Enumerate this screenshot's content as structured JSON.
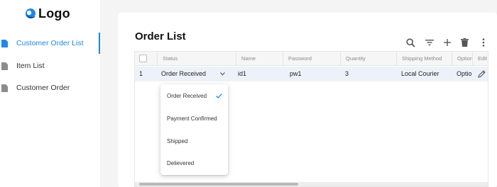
{
  "app": {
    "logo_text": "Logo",
    "accent_color": "#1e88e5"
  },
  "sidebar": {
    "items": [
      {
        "label": "Customer Order List",
        "icon": "document-icon",
        "active": true
      },
      {
        "label": "Item List",
        "icon": "document-icon",
        "active": false
      },
      {
        "label": "Customer Order",
        "icon": "document-icon",
        "active": false
      }
    ]
  },
  "page": {
    "title": "Order List",
    "toolbar": [
      "search-icon",
      "filter-icon",
      "add-icon",
      "delete-icon",
      "more-vert-icon"
    ]
  },
  "grid": {
    "columns": [
      "Status",
      "Name",
      "Password",
      "Quantity",
      "Shipping Method",
      "Option",
      "Edit"
    ],
    "rows": [
      {
        "index": "1",
        "status": "Order Received",
        "name": "id1",
        "password": "pw1",
        "quantity": "3",
        "shipping": "Local Courier",
        "option": "Optio"
      }
    ]
  },
  "status_dropdown": {
    "options": [
      "Order Received",
      "Payment Confirmed",
      "Shipped",
      "Delievered"
    ],
    "selected": "Order Received"
  }
}
